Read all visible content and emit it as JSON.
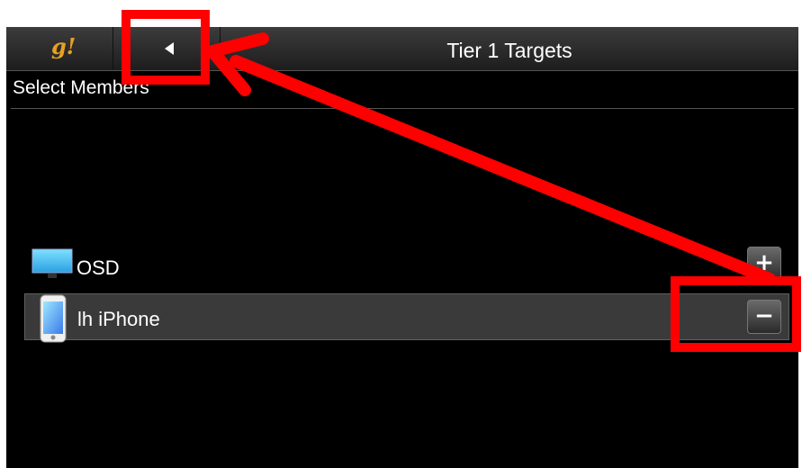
{
  "header": {
    "logo_text": "g!",
    "title": "Tier 1 Targets",
    "back_icon": "chevron-left-icon"
  },
  "section": {
    "label": "Select Members"
  },
  "members": [
    {
      "label": "OSD",
      "icon": "tv-icon",
      "action": "+"
    },
    {
      "label": "lh  iPhone",
      "icon": "phone-icon",
      "action": "−"
    }
  ],
  "colors": {
    "logo": "#e8a020",
    "annotation": "#ff0000",
    "selected_row": "#3a3a3a"
  }
}
